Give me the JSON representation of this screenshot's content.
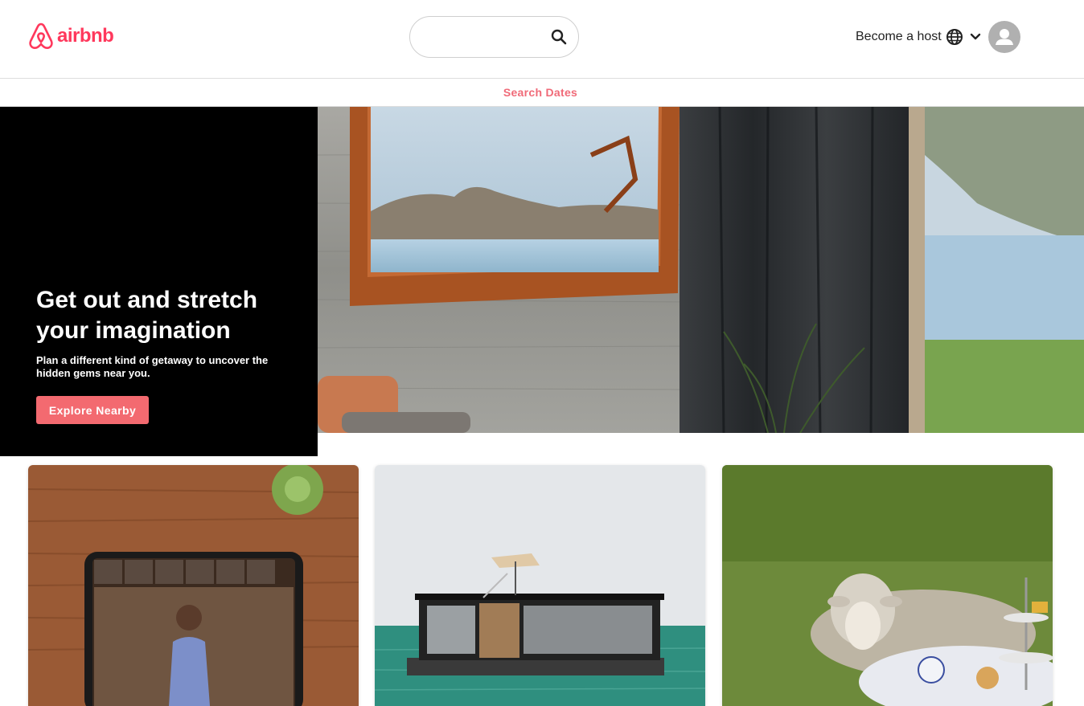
{
  "app": {
    "brand": "airbnb",
    "accent_color": "#ff385c",
    "button_color": "#f36a70"
  },
  "header": {
    "search": {
      "placeholder": "",
      "value": "",
      "icon": "search-icon"
    },
    "host_link": "Become a host",
    "globe_icon": "globe-icon",
    "menu_icon": "chevron-down-icon",
    "avatar_icon": "user-icon"
  },
  "subbar": {
    "search_dates": "Search Dates"
  },
  "hero": {
    "title": "Get out and stretch your imagination",
    "subtitle": "Plan a different kind of getaway to uncover the hidden gems near you.",
    "cta": "Explore Nearby",
    "image": "cabin-window-lake-view"
  },
  "cards": [
    {
      "image": "online-experience-tablet-video-call"
    },
    {
      "image": "floating-houseboat-on-sea"
    },
    {
      "image": "sheep-at-tea-table"
    }
  ]
}
